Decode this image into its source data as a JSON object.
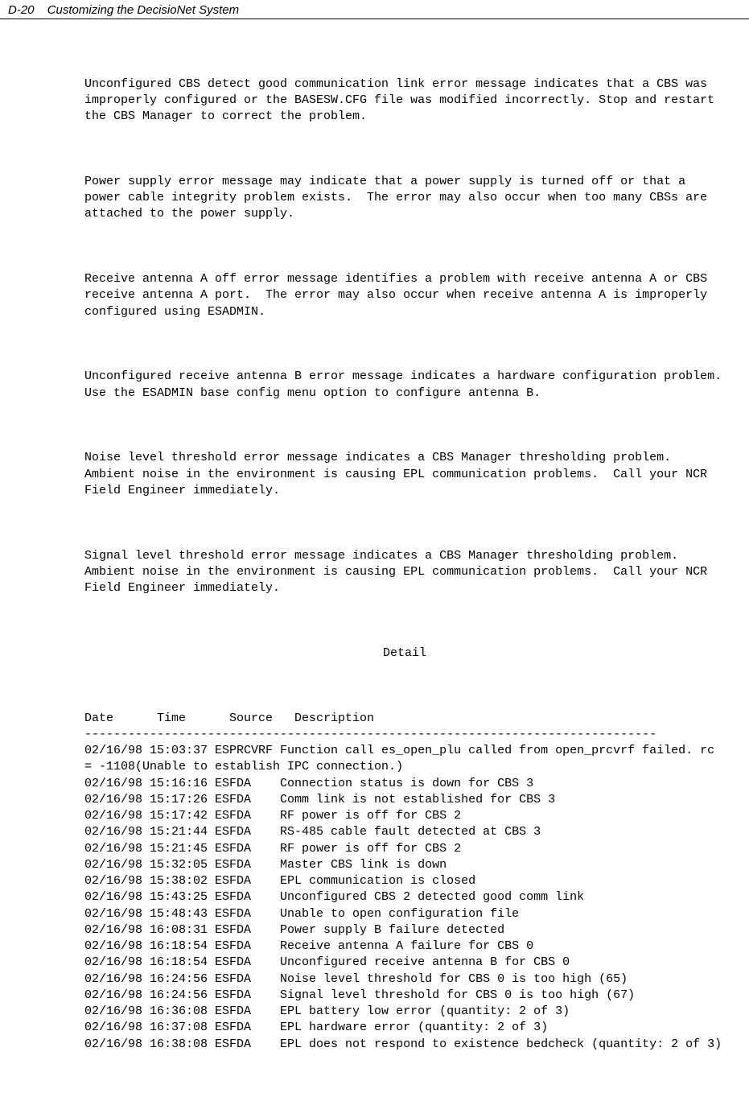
{
  "header": {
    "pageNumber": "D-20",
    "title": "Customizing the DecisioNet System"
  },
  "paragraphs": {
    "p1": "Unconfigured CBS detect good communication link error message indicates that a CBS was improperly configured or the BASESW.CFG file was modified incorrectly. Stop and restart the CBS Manager to correct the problem.",
    "p2": "Power supply error message may indicate that a power supply is turned off or that a power cable integrity problem exists.  The error may also occur when too many CBSs are attached to the power supply.",
    "p3": "Receive antenna A off error message identifies a problem with receive antenna A or CBS receive antenna A port.  The error may also occur when receive antenna A is improperly configured using ESADMIN.",
    "p4": "Unconfigured receive antenna B error message indicates a hardware configuration problem.  Use the ESADMIN base config menu option to configure antenna B.",
    "p5": "Noise level threshold error message indicates a CBS Manager thresholding problem.  Ambient noise in the environment is causing EPL communication problems.  Call your NCR Field Engineer immediately.",
    "p6": "Signal level threshold error message indicates a CBS Manager thresholding problem.  Ambient noise in the environment is causing EPL communication problems.  Call your NCR Field Engineer immediately."
  },
  "detail": {
    "heading": "Detail",
    "columnHeader": "Date      Time      Source   Description",
    "separator": "-------------------------------------------------------------------------------",
    "entries": [
      "02/16/98 15:03:37 ESPRCVRF Function call es_open_plu called from open_prcvrf failed. rc = -1108(Unable to establish IPC connection.)",
      "02/16/98 15:16:16 ESFDA    Connection status is down for CBS 3",
      "02/16/98 15:17:26 ESFDA    Comm link is not established for CBS 3",
      "02/16/98 15:17:42 ESFDA    RF power is off for CBS 2",
      "02/16/98 15:21:44 ESFDA    RS-485 cable fault detected at CBS 3",
      "02/16/98 15:21:45 ESFDA    RF power is off for CBS 2",
      "02/16/98 15:32:05 ESFDA    Master CBS link is down",
      "02/16/98 15:38:02 ESFDA    EPL communication is closed",
      "02/16/98 15:43:25 ESFDA    Unconfigured CBS 2 detected good comm link",
      "02/16/98 15:48:43 ESFDA    Unable to open configuration file",
      "02/16/98 16:08:31 ESFDA    Power supply B failure detected",
      "02/16/98 16:18:54 ESFDA    Receive antenna A failure for CBS 0",
      "02/16/98 16:18:54 ESFDA    Unconfigured receive antenna B for CBS 0",
      "02/16/98 16:24:56 ESFDA    Noise level threshold for CBS 0 is too high (65)",
      "02/16/98 16:24:56 ESFDA    Signal level threshold for CBS 0 is too high (67)",
      "02/16/98 16:36:08 ESFDA    EPL battery low error (quantity: 2 of 3)",
      "02/16/98 16:37:08 ESFDA    EPL hardware error (quantity: 2 of 3)",
      "02/16/98 16:38:08 ESFDA    EPL does not respond to existence bedcheck (quantity: 2 of 3)"
    ]
  }
}
